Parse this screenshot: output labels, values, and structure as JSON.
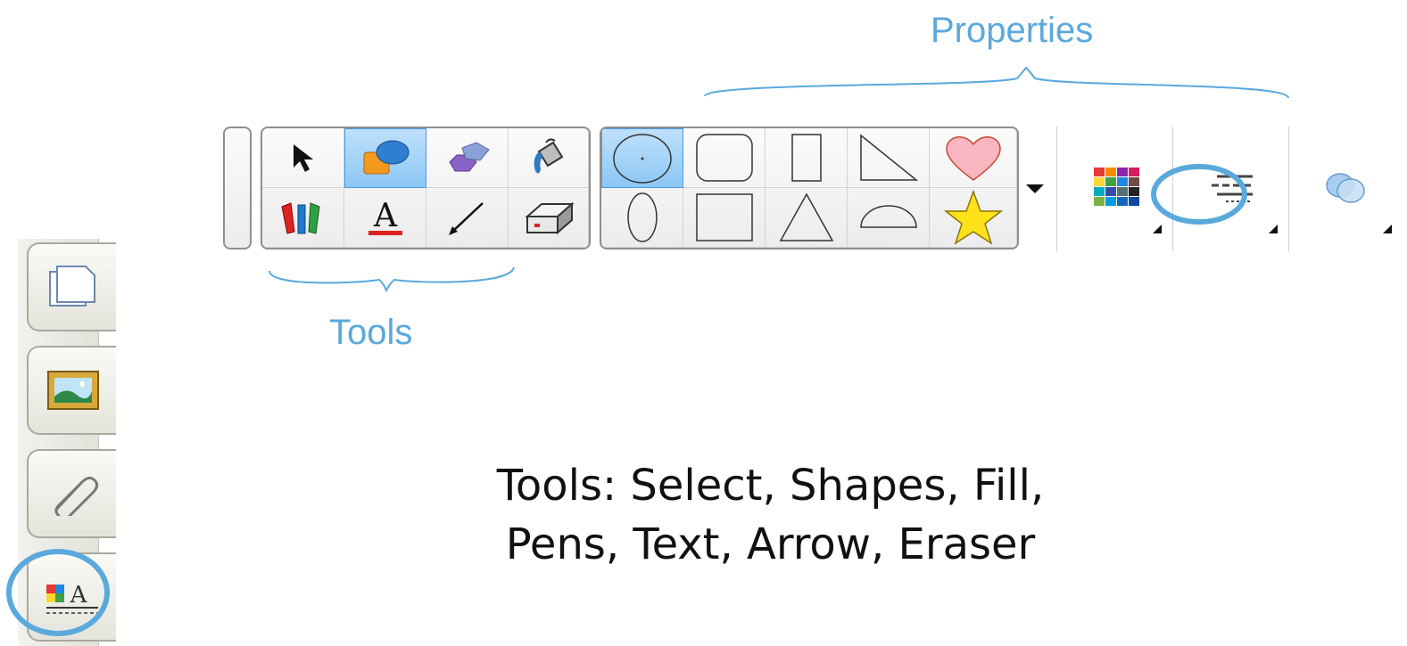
{
  "annotations": {
    "properties_label": "Properties",
    "tools_label": "Tools"
  },
  "caption": {
    "line1": "Tools: Select, Shapes, Fill,",
    "line2": "Pens, Text, Arrow, Eraser"
  },
  "toolbar": {
    "tools": [
      "Select",
      "Shapes",
      "Fill",
      "Pens",
      "Text",
      "Arrow",
      "Eraser"
    ],
    "selected_tool": "Shapes",
    "selected_shape": "circle"
  },
  "sidebar": {
    "tabs": [
      "page-sorter",
      "gallery",
      "attachments",
      "properties"
    ],
    "highlighted_tab": "properties"
  },
  "colors": {
    "annotation": "#5aa9dc",
    "selection": "#8cc7f4"
  }
}
